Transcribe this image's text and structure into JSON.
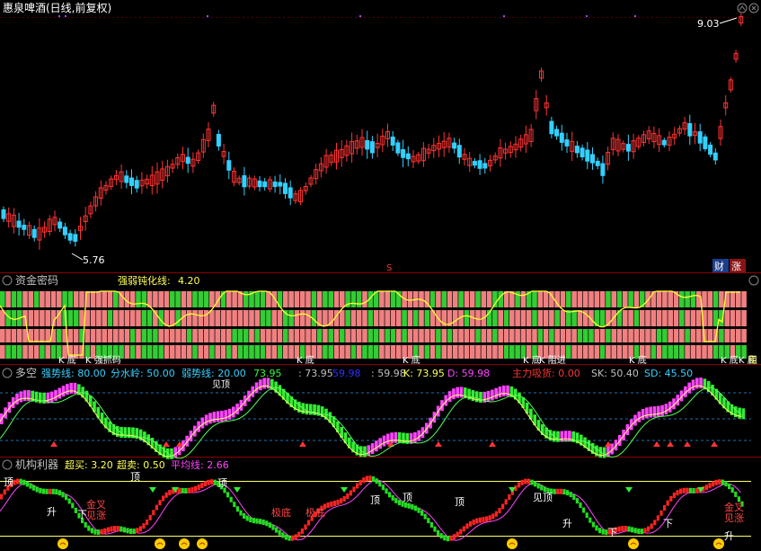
{
  "main_panel": {
    "title": "惠泉啤酒(日线,前复权)",
    "high_label": "9.03",
    "low_label": "5.76",
    "marker_s": "S",
    "badges": [
      {
        "text": "财",
        "bg": "#1c3d8a"
      },
      {
        "text": "涨",
        "bg": "#8a1414"
      }
    ],
    "colors": {
      "up": "#ff3333",
      "down": "#33d0ff"
    }
  },
  "panel1": {
    "title": "资金密码",
    "indicator_label": "强弱钝化线:",
    "indicator_value": "4.20",
    "bottom_labels": [
      "K 底",
      "K 强抓码",
      "K 底",
      "K 底",
      "K 底",
      "K 阻进",
      "K 底",
      "K 底",
      "K 底"
    ],
    "end_label": "阻"
  },
  "panel2": {
    "title": "多空",
    "items": [
      {
        "label": "强势线:",
        "value": "80.00",
        "color": "#33d0ff"
      },
      {
        "label": "分水岭:",
        "value": "50.00",
        "color": "#33d0ff"
      },
      {
        "label": "弱势线:",
        "value": "20.00",
        "color": "#33d0ff"
      },
      {
        "label": "",
        "value": "73.95",
        "color": "#33ff33"
      },
      {
        "label": ":",
        "value": "73.95",
        "color": "#c0c0c0"
      },
      {
        "label": "",
        "value": "59.98",
        "color": "#3030ff"
      },
      {
        "label": ":",
        "value": "59.98",
        "color": "#c0c0c0"
      },
      {
        "label": "K:",
        "value": "73.95",
        "color": "#ffff55"
      },
      {
        "label": "D:",
        "value": "59.98",
        "color": "#ff44ff"
      },
      {
        "label": "主力吸货:",
        "value": "0.00",
        "color": "#ff3333"
      },
      {
        "label": "SK:",
        "value": "50.40",
        "color": "#c0c0c0"
      },
      {
        "label": "SD:",
        "value": "45.50",
        "color": "#33d0ff"
      }
    ],
    "top_text": "见顶"
  },
  "panel3": {
    "title": "机构利器",
    "items": [
      {
        "label": "超买:",
        "value": "3.20",
        "color": "#ffff55"
      },
      {
        "label": "超卖:",
        "value": "0.50",
        "color": "#ffff55"
      },
      {
        "label": "平均线:",
        "value": "2.66",
        "color": "#ff44ff"
      }
    ],
    "annotations": [
      {
        "text": "顶",
        "color": "#ffffff"
      },
      {
        "text": "升",
        "color": "#ffffff"
      },
      {
        "text": "金叉",
        "color": "#ff4444"
      },
      {
        "text": "见涨",
        "color": "#ff4444"
      },
      {
        "text": "下",
        "color": "#ffffff"
      },
      {
        "text": "顶",
        "color": "#ffffff"
      },
      {
        "text": "顶",
        "color": "#ffffff"
      },
      {
        "text": "极底",
        "color": "#ff4444"
      },
      {
        "text": "极底",
        "color": "#ff4444"
      },
      {
        "text": "顶",
        "color": "#ffffff"
      },
      {
        "text": "顶",
        "color": "#ffffff"
      },
      {
        "text": "顶",
        "color": "#ffffff"
      },
      {
        "text": "见顶",
        "color": "#ffffff"
      },
      {
        "text": "升",
        "color": "#ffffff"
      },
      {
        "text": "下",
        "color": "#ffffff"
      },
      {
        "text": "下",
        "color": "#ffffff"
      },
      {
        "text": "金叉",
        "color": "#ff4444"
      },
      {
        "text": "见涨",
        "color": "#ff4444"
      },
      {
        "text": "升",
        "color": "#ffffff"
      }
    ]
  }
}
